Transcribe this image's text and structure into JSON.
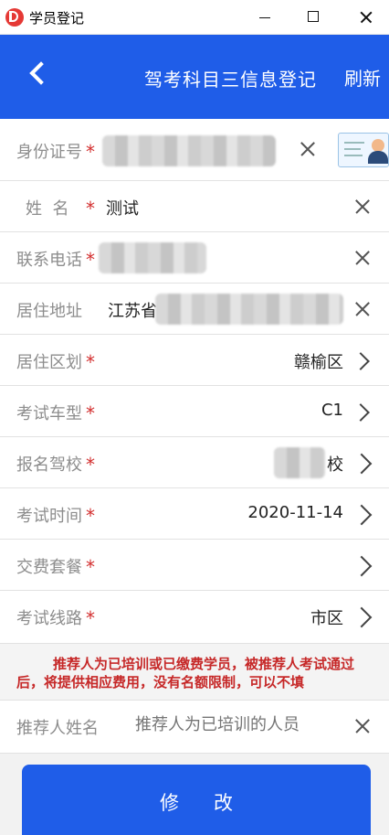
{
  "window": {
    "title": "学员登记"
  },
  "header": {
    "title": "驾考科目三信息登记",
    "refresh_label": "刷新"
  },
  "form": {
    "id_number": {
      "label": "身份证号",
      "required": "*"
    },
    "name": {
      "label": "姓  名",
      "required": "*",
      "value": "测试"
    },
    "phone": {
      "label": "联系电话",
      "required": "*"
    },
    "address": {
      "label": "居住地址",
      "value": "江苏省"
    },
    "district": {
      "label": "居住区划",
      "required": "*",
      "value": "赣榆区"
    },
    "car_type": {
      "label": "考试车型",
      "required": "*",
      "value": "C1"
    },
    "school": {
      "label": "报名驾校",
      "required": "*",
      "value": "校"
    },
    "exam_time": {
      "label": "考试时间",
      "required": "*",
      "value": "2020-11-14"
    },
    "package": {
      "label": "交费套餐",
      "required": "*"
    },
    "route": {
      "label": "考试线路",
      "required": "*",
      "value": "市区"
    }
  },
  "notice": {
    "text": "推荐人为已培训或已缴费学员，被推荐人考试通过后，将提供相应费用，没有名额限制，可以不填"
  },
  "referrer": {
    "label": "推荐人姓名",
    "placeholder": "推荐人为已培训的人员"
  },
  "submit": {
    "label": "修改"
  },
  "colors": {
    "primary": "#1f5de8",
    "required": "#d32f2f",
    "notice": "#c62828"
  }
}
